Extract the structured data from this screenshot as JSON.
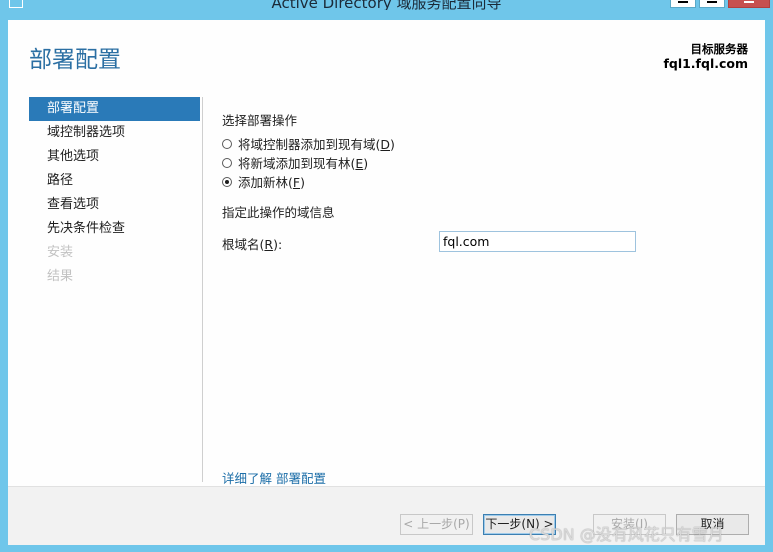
{
  "window": {
    "title": "Active Directory 域服务配置向导"
  },
  "header": {
    "page_title": "部署配置",
    "target_label": "目标服务器",
    "target_name": "fql1.fql.com"
  },
  "nav": {
    "items": [
      {
        "label": "部署配置",
        "state": "selected"
      },
      {
        "label": "域控制器选项",
        "state": "normal"
      },
      {
        "label": "其他选项",
        "state": "normal"
      },
      {
        "label": "路径",
        "state": "normal"
      },
      {
        "label": "查看选项",
        "state": "normal"
      },
      {
        "label": "先决条件检查",
        "state": "normal"
      },
      {
        "label": "安装",
        "state": "disabled"
      },
      {
        "label": "结果",
        "state": "disabled"
      }
    ]
  },
  "content": {
    "operation_label": "选择部署操作",
    "options": [
      {
        "text": "将域控制器添加到现有域(",
        "key": "D",
        "end": ")",
        "checked": false
      },
      {
        "text": "将新域添加到现有林(",
        "key": "E",
        "end": ")",
        "checked": false
      },
      {
        "text": "添加新林(",
        "key": "F",
        "end": ")",
        "checked": true
      }
    ],
    "domain_info_label": "指定此操作的域信息",
    "root_domain": {
      "label_prefix": "根域名(",
      "label_key": "R",
      "label_suffix": "):",
      "value": "fql.com"
    },
    "more_link": "详细了解 部署配置"
  },
  "footer": {
    "prev_label": "< 上一步(P)",
    "next_label": "下一步(N) >",
    "install_label": "安装(I)",
    "cancel_label": "取消"
  },
  "watermark": "CSDN @没有风花只有雪月",
  "colors": {
    "title_bar": "#6fc6ea",
    "accent": "#2b6fa3",
    "nav_selected": "#2a7ab8",
    "link": "#1c6ea8"
  }
}
